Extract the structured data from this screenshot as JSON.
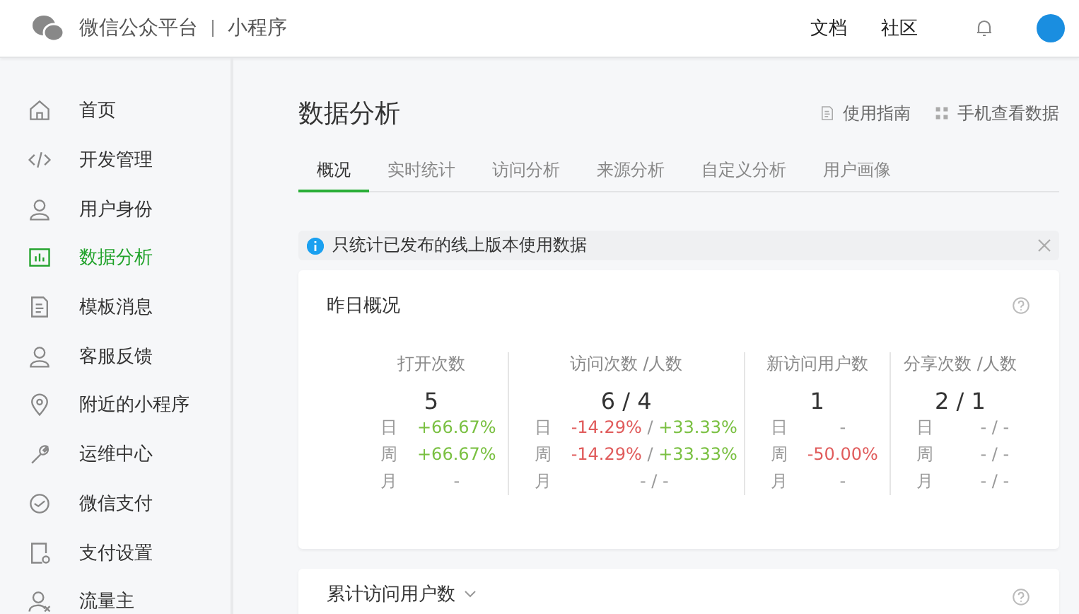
{
  "header": {
    "brand": "微信公众平台",
    "product": "小程序",
    "links": [
      "文档",
      "社区"
    ]
  },
  "sidebar": {
    "items": [
      {
        "label": "首页",
        "selected": false
      },
      {
        "label": "开发管理",
        "selected": false
      },
      {
        "label": "用户身份",
        "selected": false
      },
      {
        "label": "数据分析",
        "selected": true
      },
      {
        "label": "模板消息",
        "selected": false
      },
      {
        "label": "客服反馈",
        "selected": false
      },
      {
        "label": "附近的小程序",
        "selected": false
      },
      {
        "label": "运维中心",
        "selected": false
      },
      {
        "label": "微信支付",
        "selected": false
      },
      {
        "label": "支付设置",
        "selected": false
      },
      {
        "label": "流量主",
        "selected": false
      }
    ]
  },
  "page": {
    "title": "数据分析",
    "actions": [
      "使用指南",
      "手机查看数据"
    ]
  },
  "tabs": [
    {
      "label": "概况",
      "selected": true
    },
    {
      "label": "实时统计",
      "selected": false
    },
    {
      "label": "访问分析",
      "selected": false
    },
    {
      "label": "来源分析",
      "selected": false
    },
    {
      "label": "自定义分析",
      "selected": false
    },
    {
      "label": "用户画像",
      "selected": false
    }
  ],
  "notice": {
    "text": "只统计已发布的线上版本使用数据"
  },
  "overview": {
    "title": "昨日概况",
    "metrics": [
      {
        "label": "打开次数",
        "value": "5",
        "rows": [
          {
            "period": "日",
            "parts": [
              {
                "text": "+66.67%",
                "kind": "up"
              }
            ]
          },
          {
            "period": "周",
            "parts": [
              {
                "text": "+66.67%",
                "kind": "up"
              }
            ]
          },
          {
            "period": "月",
            "parts": [
              {
                "text": "-",
                "kind": "flat"
              }
            ]
          }
        ]
      },
      {
        "label": "访问次数 /人数",
        "value": "6 / 4",
        "rows": [
          {
            "period": "日",
            "parts": [
              {
                "text": "-14.29%",
                "kind": "down"
              },
              {
                "text": "/",
                "kind": "flat"
              },
              {
                "text": "+33.33%",
                "kind": "up"
              }
            ]
          },
          {
            "period": "周",
            "parts": [
              {
                "text": "-14.29%",
                "kind": "down"
              },
              {
                "text": "/",
                "kind": "flat"
              },
              {
                "text": "+33.33%",
                "kind": "up"
              }
            ]
          },
          {
            "period": "月",
            "parts": [
              {
                "text": "- / -",
                "kind": "flat"
              }
            ]
          }
        ]
      },
      {
        "label": "新访问用户数",
        "value": "1",
        "rows": [
          {
            "period": "日",
            "parts": [
              {
                "text": "-",
                "kind": "flat"
              }
            ]
          },
          {
            "period": "周",
            "parts": [
              {
                "text": "-50.00%",
                "kind": "down"
              }
            ]
          },
          {
            "period": "月",
            "parts": [
              {
                "text": "-",
                "kind": "flat"
              }
            ]
          }
        ]
      },
      {
        "label": "分享次数 /人数",
        "value": "2 / 1",
        "rows": [
          {
            "period": "日",
            "parts": [
              {
                "text": "- / -",
                "kind": "flat"
              }
            ]
          },
          {
            "period": "周",
            "parts": [
              {
                "text": "- / -",
                "kind": "flat"
              }
            ]
          },
          {
            "period": "月",
            "parts": [
              {
                "text": "- / -",
                "kind": "flat"
              }
            ]
          }
        ]
      }
    ]
  },
  "cumulative": {
    "title": "累计访问用户数"
  }
}
